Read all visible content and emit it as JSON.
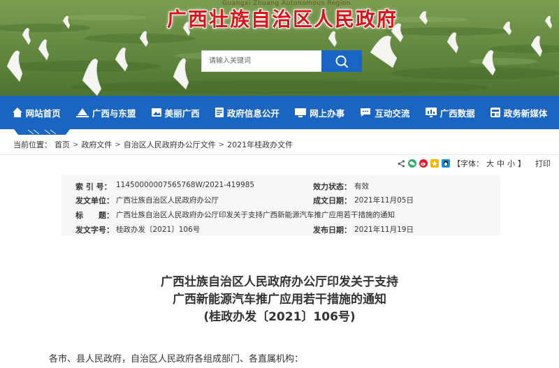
{
  "header": {
    "site_en": "Guangxi Zhuang Autonomous Region",
    "site_title": "广西壮族自治区人民政府",
    "search_placeholder": "请输入关键词",
    "search_icon": "search-icon"
  },
  "nav": {
    "items": [
      {
        "label": "网站首页",
        "icon": "home-icon"
      },
      {
        "label": "广西与东盟",
        "icon": "landmark-icon"
      },
      {
        "label": "美丽广西",
        "icon": "landscape-icon"
      },
      {
        "label": "政府信息公开",
        "icon": "document-icon"
      },
      {
        "label": "网上办事",
        "icon": "monitor-icon"
      },
      {
        "label": "互动交流",
        "icon": "chat-icon"
      },
      {
        "label": "广西数据",
        "icon": "chart-icon"
      },
      {
        "label": "政务新媒体",
        "icon": "media-icon"
      }
    ]
  },
  "breadcrumb": {
    "prefix": "当前位置：",
    "items": [
      "首页",
      "政府文件",
      "自治区人民政府办公厅文件",
      "2021年桂政办文件"
    ],
    "sep": ">"
  },
  "tools": {
    "font_label": "【字体：",
    "sizes": [
      "大",
      "中",
      "小"
    ],
    "font_close": "】",
    "print": "打印"
  },
  "meta": {
    "index_label": "索 引 号：",
    "index_value": "11450000007565768W/2021-419985",
    "status_label": "效力状态：",
    "status_value": "有效",
    "issuer_label": "发文单位：",
    "issuer_value": "广西壮族自治区人民政府办公厅",
    "date_label": "成文日期：",
    "date_value": "2021年11月05日",
    "title_label": "标　　题：",
    "title_value": "广西壮族自治区人民政府办公厅印发关于支持广西新能源汽车推广应用若干措施的通知",
    "doc_no_label": "发文字号：",
    "doc_no_value": "桂政办发〔2021〕106号",
    "publish_label": "发布日期：",
    "publish_value": "2021年11月19日"
  },
  "article": {
    "title_line1": "广西壮族自治区人民政府办公厅印发关于支持",
    "title_line2": "广西新能源汽车推广应用若干措施的通知",
    "title_line3": "(桂政办发〔2021〕106号)",
    "salutation": "各市、县人民政府，自治区人民政府各组成部门、各直属机构："
  },
  "colors": {
    "brand_blue": "#1b65c2",
    "title_red": "#d8141a"
  }
}
